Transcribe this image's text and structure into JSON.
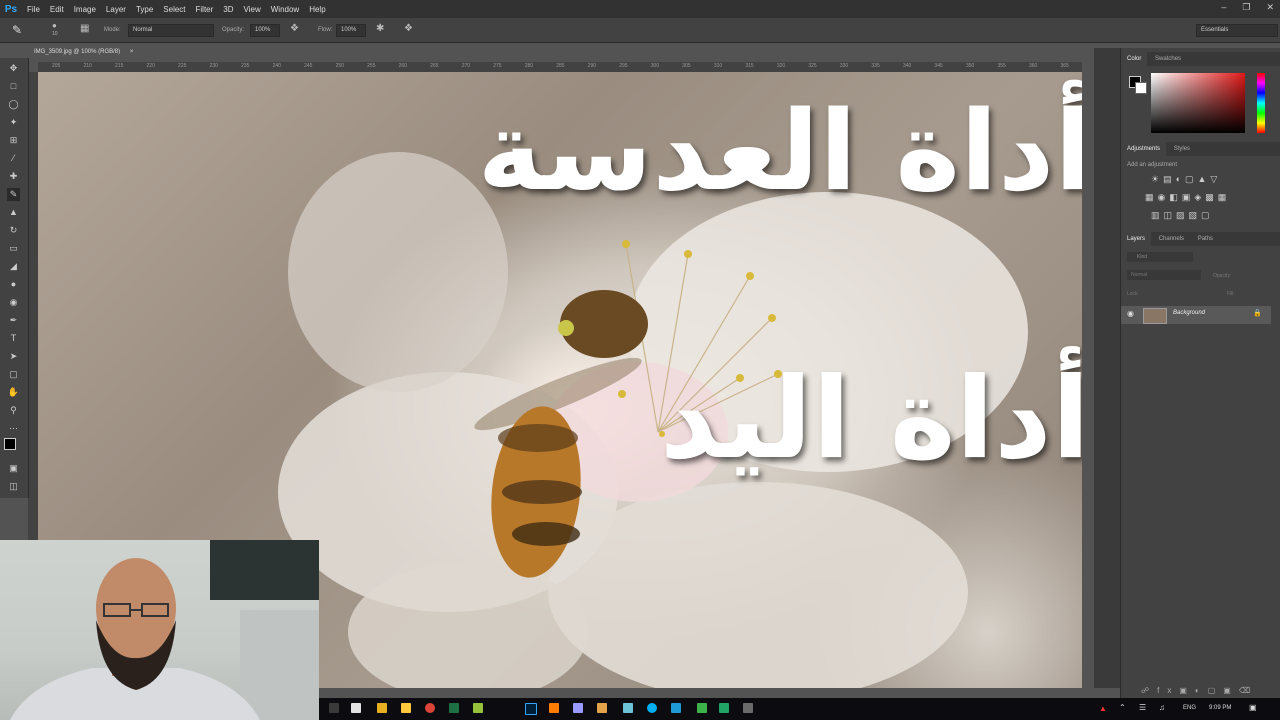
{
  "menu": {
    "app_logo": "Ps",
    "items": [
      "File",
      "Edit",
      "Image",
      "Layer",
      "Type",
      "Select",
      "Filter",
      "3D",
      "View",
      "Window",
      "Help"
    ]
  },
  "options_bar": {
    "brush_size": "10",
    "mode_label": "Mode:",
    "mode_value": "Normal",
    "opacity_label": "Opacity:",
    "opacity_value": "100%",
    "flow_label": "Flow:",
    "flow_value": "100%",
    "workspace": "Essentials"
  },
  "document": {
    "tab_title": "IMG_3509.jpg @ 100% (RGB/8)",
    "close": "×"
  },
  "ruler": {
    "ticks": [
      "205",
      "210",
      "215",
      "220",
      "225",
      "230",
      "235",
      "240",
      "245",
      "250",
      "255",
      "260",
      "265",
      "270",
      "275",
      "280",
      "285",
      "290",
      "295",
      "300",
      "305",
      "310",
      "315",
      "320",
      "325",
      "330",
      "335",
      "340",
      "345",
      "350",
      "355",
      "360",
      "365"
    ]
  },
  "overlay_text": {
    "line1": "أداة العدسة",
    "line2": "أداة اليد"
  },
  "panels": {
    "color_tabs": [
      "Color",
      "Swatches"
    ],
    "adjust_tabs": [
      "Adjustments",
      "Styles"
    ],
    "adjust_hint": "Add an adjustment",
    "layers_tabs": [
      "Layers",
      "Channels",
      "Paths"
    ],
    "layer_kind": "Kind",
    "layer_blend": "Normal",
    "layer_opacity_label": "Opacity:",
    "lock_label": "Lock:",
    "fill_label": "Fill:",
    "layer_name": "Background"
  },
  "taskbar": {
    "lang": "ENG",
    "time": "9:09 PM"
  },
  "colors": {
    "accent": "#31a8ff",
    "menubar": "#323232",
    "panel": "#424242",
    "canvas_bg": "#535353"
  }
}
